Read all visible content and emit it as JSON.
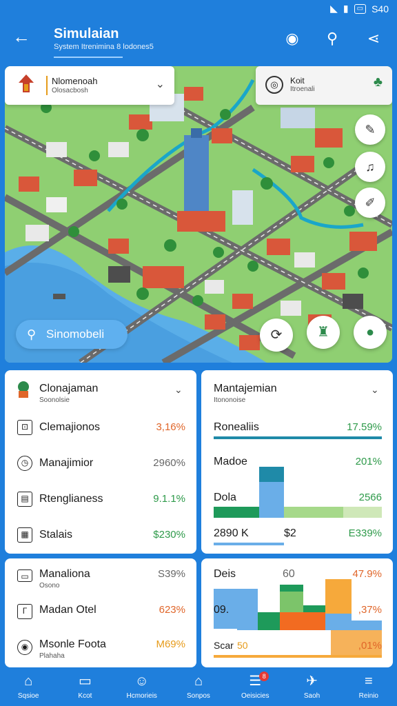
{
  "status": {
    "time": "S40"
  },
  "header": {
    "title": "Simulaian",
    "subtitle": "System Itrenimina 8 lodones5"
  },
  "map": {
    "location_card": {
      "title": "Nlomenoah",
      "subtitle": "Olosacbosh"
    },
    "point_card": {
      "title": "Koit",
      "subtitle": "Itroenali"
    },
    "search_label": "Sinomobeli"
  },
  "left_panel_1": {
    "title": "Clonajaman",
    "subtitle": "Soonolsie",
    "rows": [
      {
        "label": "Clemajionos",
        "value": "3,16%",
        "color": "#e0662a"
      },
      {
        "label": "Manajimior",
        "value": "2960%",
        "color": "#666666"
      },
      {
        "label": "Rtenglianess",
        "value": "9.1.1%",
        "color": "#2e9a4a"
      },
      {
        "label": "Stalais",
        "value": "$230%",
        "color": "#2e9a4a"
      }
    ]
  },
  "right_panel_1": {
    "title": "Mantajemian",
    "subtitle": "Itononoise",
    "rows": [
      {
        "label": "Ronealiis",
        "value": "17.59%",
        "color": "#2e9a4a"
      },
      {
        "label": "Madoe",
        "value": "201%",
        "color": "#2e9a4a"
      },
      {
        "label": "Dola",
        "value": "2566",
        "color": "#2e9a4a"
      }
    ],
    "footer_left": "2890 K",
    "footer_mid": "$2",
    "footer_right": "E339%"
  },
  "left_panel_2": {
    "rows": [
      {
        "label": "Manaliona",
        "sub": "Osono",
        "value": "S39%",
        "color": "#666666"
      },
      {
        "label": "Madan Otel",
        "sub": "",
        "value": "623%",
        "color": "#e0662a"
      },
      {
        "label": "Msonle Foota",
        "sub": "Plahaha",
        "value": "M69%",
        "color": "#e69b1a"
      }
    ]
  },
  "right_panel_2": {
    "label_top": "Deis",
    "label_mid_value": "60",
    "label_right": "47.9%",
    "label_row2": "09.",
    "label_row2_right": ",37%",
    "label_row3": "Scar",
    "label_row3_value": "50",
    "label_row3_right": ",01%"
  },
  "bottom_nav": [
    {
      "label": "Sqsioe",
      "icon": "home-icon"
    },
    {
      "label": "Kcot",
      "icon": "monitor-icon"
    },
    {
      "label": "Hcmorieis",
      "icon": "person-icon"
    },
    {
      "label": "Sonpos",
      "icon": "building-icon"
    },
    {
      "label": "Oeisicies",
      "icon": "list-icon",
      "badge": "8"
    },
    {
      "label": "Saoh",
      "icon": "tool-icon"
    },
    {
      "label": "Reinio",
      "icon": "menu-icon"
    }
  ]
}
